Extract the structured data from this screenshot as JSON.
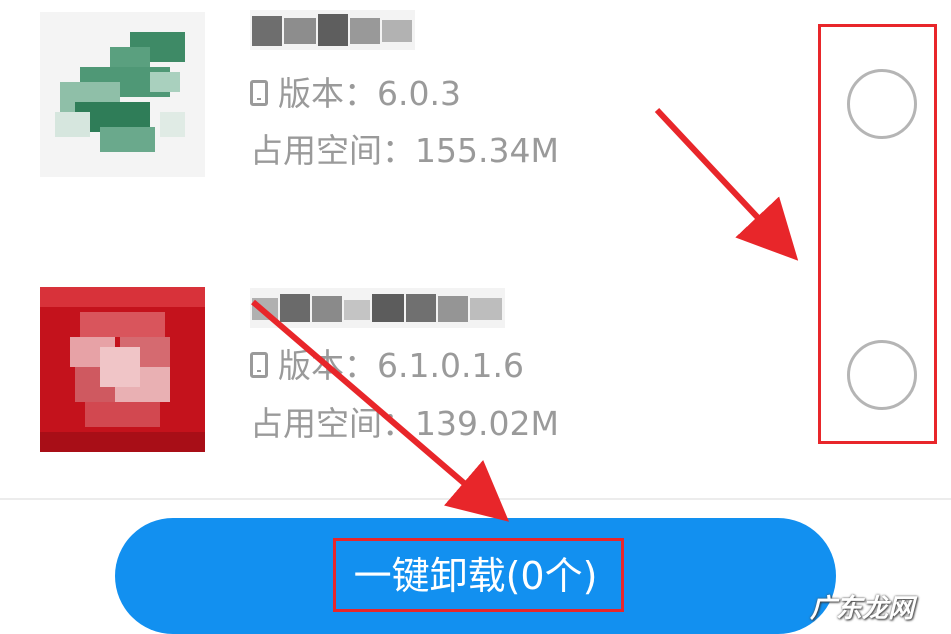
{
  "apps": [
    {
      "version_label": "版本：",
      "version": "6.0.3",
      "size_label": "占用空间：",
      "size": "155.34M",
      "selected": false
    },
    {
      "version_label": "版本：",
      "version": "6.1.0.1.6",
      "size_label": "占用空间：",
      "size": "139.02M",
      "selected": false
    }
  ],
  "uninstall_button": {
    "label": "一键卸载(0个)"
  },
  "watermark": "广东龙网",
  "colors": {
    "button": "#1290f0",
    "annotation": "#e8262a",
    "meta_text": "#9a9a9a"
  }
}
